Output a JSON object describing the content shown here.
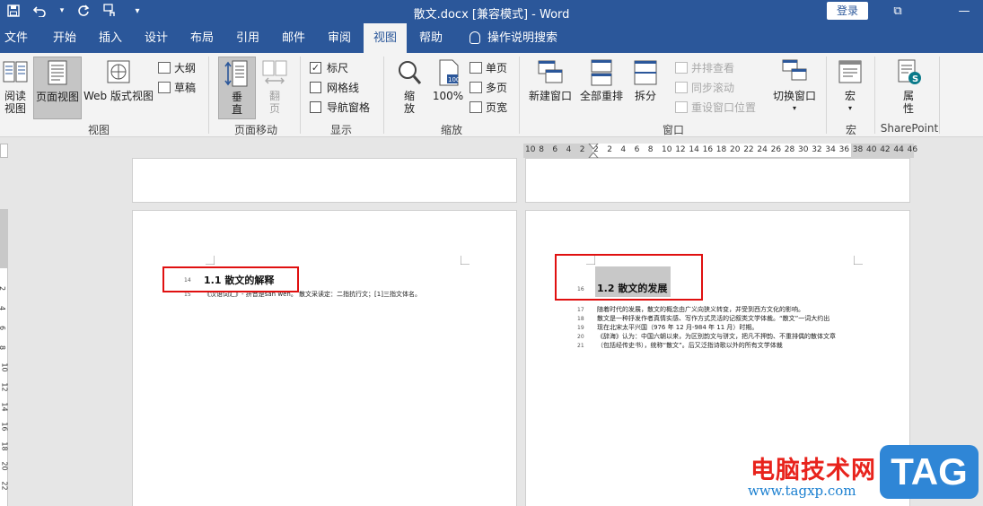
{
  "titlebar": {
    "title": "散文.docx [兼容模式]  -  Word",
    "login": "登录",
    "restore_glyph": "⧉",
    "minimize_glyph": "—",
    "qat_icons": [
      "save-icon",
      "undo-icon",
      "redo-icon",
      "touch-mode-icon",
      "customize-qat-icon"
    ]
  },
  "tabs": [
    "文件",
    "开始",
    "插入",
    "设计",
    "布局",
    "引用",
    "邮件",
    "审阅",
    "视图",
    "帮助",
    "操作说明搜索"
  ],
  "active_tab": "视图",
  "ribbon": {
    "view_group": {
      "label": "视图",
      "read_mode": "阅读\n视图",
      "read_mode_l1": "阅读",
      "read_mode_l2": "视图",
      "print_layout": "页面视图",
      "web_layout": "Web 版式视图",
      "outline": "大纲",
      "draft": "草稿"
    },
    "page_move": {
      "label": "页面移动",
      "vertical_l1": "垂",
      "vertical_l2": "直",
      "side_l1": "翻",
      "side_l2": "页"
    },
    "show": {
      "label": "显示",
      "ruler": "标尺",
      "ruler_checked": true,
      "gridlines": "网格线",
      "gridlines_checked": false,
      "nav_pane": "导航窗格",
      "nav_pane_checked": false
    },
    "zoom": {
      "label": "缩放",
      "zoom_l1": "缩",
      "zoom_l2": "放",
      "hundred": "100%",
      "one_page": "单页",
      "multi_page": "多页",
      "page_width": "页宽"
    },
    "window": {
      "label": "窗口",
      "new_window": "新建窗口",
      "arrange_all": "全部重排",
      "split": "拆分",
      "side_by_side": "并排查看",
      "sync_scroll": "同步滚动",
      "reset_position": "重设窗口位置",
      "switch_windows": "切换窗口"
    },
    "macros": {
      "label": "宏",
      "button": "宏"
    },
    "sharepoint": {
      "label": "SharePoint",
      "button_l1": "属",
      "button_l2": "性"
    }
  },
  "ruler": {
    "h_numbers": [
      "10",
      "8",
      "6",
      "4",
      "2",
      "2",
      "2",
      "4",
      "6",
      "8",
      "10",
      "12",
      "14",
      "16",
      "18",
      "20",
      "22",
      "24",
      "26",
      "28",
      "30",
      "32",
      "34",
      "36",
      "38",
      "40",
      "42",
      "44",
      "46"
    ],
    "v_numbers": [
      "2",
      "4",
      "6",
      "8",
      "10",
      "12",
      "14",
      "16",
      "18",
      "20",
      "22"
    ]
  },
  "document": {
    "left_page": {
      "heading_line": "14",
      "heading": "1.1 散文的解释",
      "line15_num": "15",
      "line15": "《汉语词汇》- 拼音是sǎn wén。   散文采读定：二指抗行文；[1]三指文体名。"
    },
    "right_page": {
      "heading_line": "16",
      "heading": "1.2 散文的发展",
      "lines": [
        {
          "n": "17",
          "t": "随着时代的发展，散文的概念由广义向狭义转变，并受到西方文化的影响。"
        },
        {
          "n": "18",
          "t": "散文是一种抒发作者真情实感、写作方式灵活的记叙类文学体裁。“散文”一词大约出"
        },
        {
          "n": "19",
          "t": "现在北宋太平兴国（976 年 12 月-984 年 11 月）时期。"
        },
        {
          "n": "20",
          "t": "《辞海》认为：中国六朝以来，为区别韵文与骈文，把凡不押韵、不重排偶的散体文章"
        },
        {
          "n": "21",
          "t": "（包括经传史书），统称“散文”。后又泛指诗歌以外的所有文学体裁"
        }
      ]
    }
  },
  "watermark": {
    "site": "电脑技术网",
    "url": "www.tagxp.com",
    "badge": "TAG"
  },
  "colors": {
    "word_blue": "#2b579a",
    "highlight_red": "#e01010",
    "heading_highlight": "#c8c8c8"
  }
}
